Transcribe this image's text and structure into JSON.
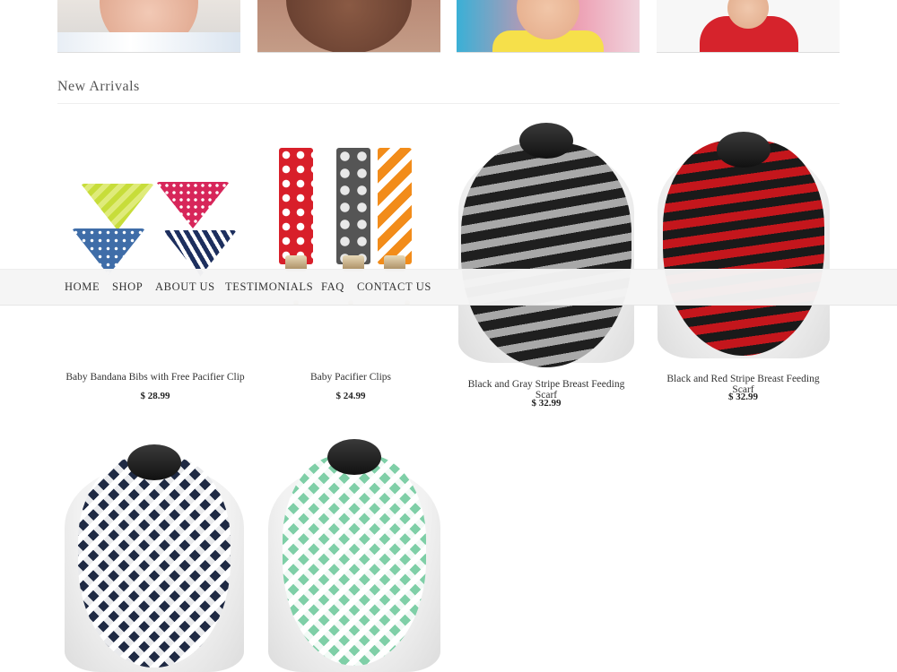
{
  "nav": {
    "items": [
      {
        "label": "HOME"
      },
      {
        "label": "SHOP"
      },
      {
        "label": "ABOUT US"
      },
      {
        "label": "TESTIMONIALS"
      },
      {
        "label": "FAQ"
      },
      {
        "label": "CONTACT US"
      }
    ]
  },
  "categories": [
    {
      "image": "baby-photo"
    },
    {
      "image": "baby-photo"
    },
    {
      "image": "baby-photo"
    },
    {
      "image": "baby-photo"
    }
  ],
  "new_arrivals": {
    "title": "New Arrivals",
    "products": [
      {
        "name": "Baby Bandana Bibs with Free Pacifier Clip",
        "price": "$ 28.99"
      },
      {
        "name": "Baby Pacifier Clips",
        "price": "$ 24.99"
      },
      {
        "name": "Black and Gray Stripe Breast Feeding Scarf",
        "price": "$ 32.99"
      },
      {
        "name": "Black and Red Stripe Breast Feeding Scarf",
        "price": "$ 32.99"
      },
      {
        "name": "",
        "price": ""
      },
      {
        "name": "",
        "price": ""
      }
    ]
  },
  "colors": {
    "navbar_bg": "#f5f5f5",
    "text": "#333333",
    "scarf_gray": "#9a9a9a",
    "scarf_black": "#1f1f1f",
    "scarf_red": "#c4161c",
    "scarf_navy": "#1f2a44",
    "scarf_mint": "#7fcfa7"
  }
}
